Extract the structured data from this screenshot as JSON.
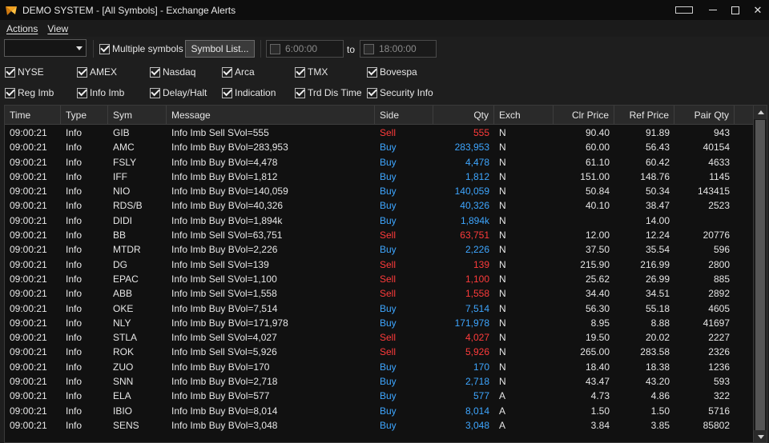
{
  "window": {
    "title": "DEMO SYSTEM - [All Symbols] - Exchange Alerts"
  },
  "menu": {
    "actions": "Actions",
    "view": "View"
  },
  "toolbar": {
    "symbol_dropdown_value": "",
    "multiple_symbols_label": "Multiple symbols",
    "multiple_symbols_checked": true,
    "symbol_list_button": "Symbol List...",
    "start_time": "6:00:00",
    "to_label": "to",
    "end_time": "18:00:00"
  },
  "exchanges": [
    {
      "label": "NYSE",
      "checked": true
    },
    {
      "label": "AMEX",
      "checked": true
    },
    {
      "label": "Nasdaq",
      "checked": true
    },
    {
      "label": "Arca",
      "checked": true
    },
    {
      "label": "TMX",
      "checked": true
    },
    {
      "label": "Bovespa",
      "checked": true
    }
  ],
  "alert_types": [
    {
      "label": "Reg Imb",
      "checked": true
    },
    {
      "label": "Info Imb",
      "checked": true
    },
    {
      "label": "Delay/Halt",
      "checked": true
    },
    {
      "label": "Indication",
      "checked": true
    },
    {
      "label": "Trd Dis Time",
      "checked": true
    },
    {
      "label": "Security Info",
      "checked": true
    }
  ],
  "table": {
    "columns": [
      "Time",
      "Type",
      "Sym",
      "Message",
      "Side",
      "Qty",
      "Exch",
      "Clr Price",
      "Ref Price",
      "Pair Qty"
    ],
    "rows": [
      [
        "09:00:21",
        "Info",
        "GIB",
        "Info Imb Sell  SVol=555",
        "Sell",
        "555",
        "N",
        "90.40",
        "91.89",
        "943"
      ],
      [
        "09:00:21",
        "Info",
        "AMC",
        "Info Imb Buy  BVol=283,953",
        "Buy",
        "283,953",
        "N",
        "60.00",
        "56.43",
        "40154"
      ],
      [
        "09:00:21",
        "Info",
        "FSLY",
        "Info Imb Buy  BVol=4,478",
        "Buy",
        "4,478",
        "N",
        "61.10",
        "60.42",
        "4633"
      ],
      [
        "09:00:21",
        "Info",
        "IFF",
        "Info Imb Buy  BVol=1,812",
        "Buy",
        "1,812",
        "N",
        "151.00",
        "148.76",
        "1145"
      ],
      [
        "09:00:21",
        "Info",
        "NIO",
        "Info Imb Buy  BVol=140,059",
        "Buy",
        "140,059",
        "N",
        "50.84",
        "50.34",
        "143415"
      ],
      [
        "09:00:21",
        "Info",
        "RDS/B",
        "Info Imb Buy  BVol=40,326",
        "Buy",
        "40,326",
        "N",
        "40.10",
        "38.47",
        "2523"
      ],
      [
        "09:00:21",
        "Info",
        "DIDI",
        "Info Imb Buy  BVol=1,894k",
        "Buy",
        "1,894k",
        "N",
        "",
        "14.00",
        ""
      ],
      [
        "09:00:21",
        "Info",
        "BB",
        "Info Imb Sell  SVol=63,751",
        "Sell",
        "63,751",
        "N",
        "12.00",
        "12.24",
        "20776"
      ],
      [
        "09:00:21",
        "Info",
        "MTDR",
        "Info Imb Buy  BVol=2,226",
        "Buy",
        "2,226",
        "N",
        "37.50",
        "35.54",
        "596"
      ],
      [
        "09:00:21",
        "Info",
        "DG",
        "Info Imb Sell  SVol=139",
        "Sell",
        "139",
        "N",
        "215.90",
        "216.99",
        "2800"
      ],
      [
        "09:00:21",
        "Info",
        "EPAC",
        "Info Imb Sell  SVol=1,100",
        "Sell",
        "1,100",
        "N",
        "25.62",
        "26.99",
        "885"
      ],
      [
        "09:00:21",
        "Info",
        "ABB",
        "Info Imb Sell  SVol=1,558",
        "Sell",
        "1,558",
        "N",
        "34.40",
        "34.51",
        "2892"
      ],
      [
        "09:00:21",
        "Info",
        "OKE",
        "Info Imb Buy  BVol=7,514",
        "Buy",
        "7,514",
        "N",
        "56.30",
        "55.18",
        "4605"
      ],
      [
        "09:00:21",
        "Info",
        "NLY",
        "Info Imb Buy  BVol=171,978",
        "Buy",
        "171,978",
        "N",
        "8.95",
        "8.88",
        "41697"
      ],
      [
        "09:00:21",
        "Info",
        "STLA",
        "Info Imb Sell  SVol=4,027",
        "Sell",
        "4,027",
        "N",
        "19.50",
        "20.02",
        "2227"
      ],
      [
        "09:00:21",
        "Info",
        "ROK",
        "Info Imb Sell  SVol=5,926",
        "Sell",
        "5,926",
        "N",
        "265.00",
        "283.58",
        "2326"
      ],
      [
        "09:00:21",
        "Info",
        "ZUO",
        "Info Imb Buy  BVol=170",
        "Buy",
        "170",
        "N",
        "18.40",
        "18.38",
        "1236"
      ],
      [
        "09:00:21",
        "Info",
        "SNN",
        "Info Imb Buy  BVol=2,718",
        "Buy",
        "2,718",
        "N",
        "43.47",
        "43.20",
        "593"
      ],
      [
        "09:00:21",
        "Info",
        "ELA",
        "Info Imb Buy  BVol=577",
        "Buy",
        "577",
        "A",
        "4.73",
        "4.86",
        "322"
      ],
      [
        "09:00:21",
        "Info",
        "IBIO",
        "Info Imb Buy  BVol=8,014",
        "Buy",
        "8,014",
        "A",
        "1.50",
        "1.50",
        "5716"
      ],
      [
        "09:00:21",
        "Info",
        "SENS",
        "Info Imb Buy  BVol=3,048",
        "Buy",
        "3,048",
        "A",
        "3.84",
        "3.85",
        "85802"
      ]
    ]
  },
  "colors": {
    "sell": "#ff3b3b",
    "buy": "#3ea6ff",
    "background": "#111111"
  }
}
